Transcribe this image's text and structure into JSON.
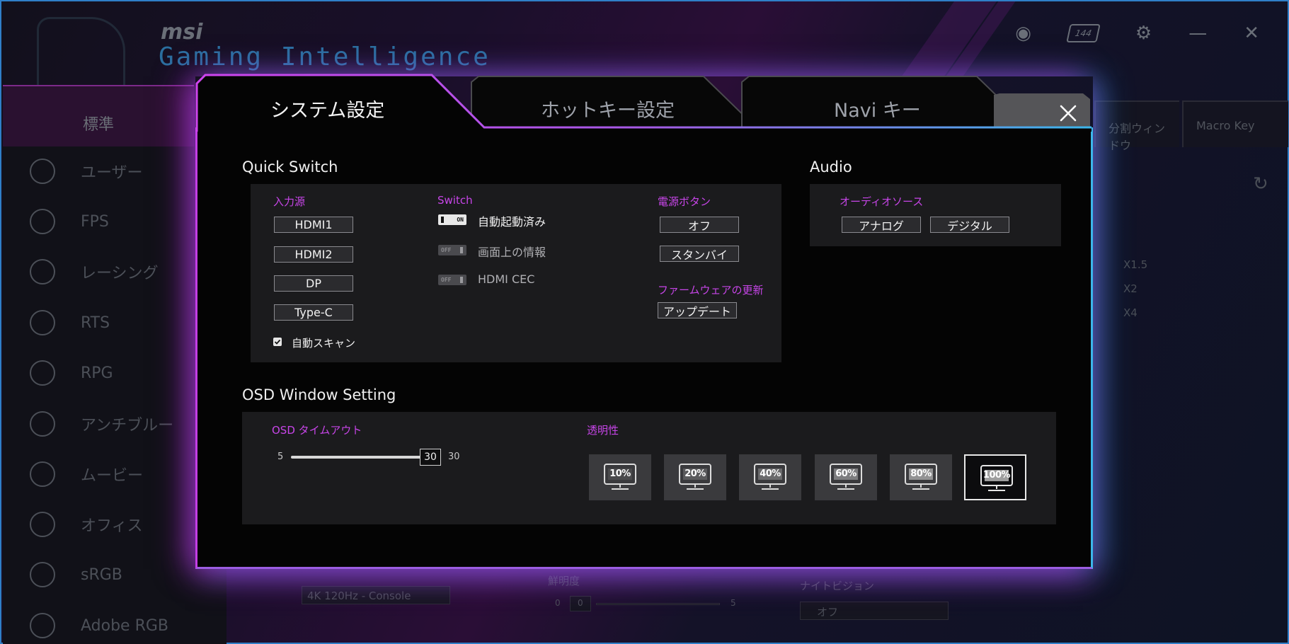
{
  "background": {
    "brand": "msi",
    "app_title": "Gaming Intelligence",
    "refresh_rate": "144",
    "std_tab": "標準",
    "sidebar": [
      "ユーザー",
      "FPS",
      "レーシング",
      "RTS",
      "RPG",
      "アンチブルー",
      "ムービー",
      "オフィス",
      "sRGB",
      "Adobe RGB"
    ],
    "right_tabs": [
      "分割ウィンドウ",
      "Macro Key"
    ],
    "zoom": [
      "X1.5",
      "X2",
      "X4"
    ],
    "resolution": "4K 120Hz - Console",
    "brightness_label": "鮮明度",
    "brightness_min": "0",
    "brightness_val": "0",
    "brightness_max": "5",
    "night_label": "ナイトビジョン",
    "night_val": "オフ"
  },
  "tabs": [
    "システム設定",
    "ホットキー設定",
    "Navi キー"
  ],
  "quick_switch": {
    "title": "Quick Switch",
    "input_label": "入力源",
    "inputs": [
      "HDMI1",
      "HDMI2",
      "DP",
      "Type-C"
    ],
    "auto_scan": "自動スキャン",
    "switch_label": "Switch",
    "switches": [
      {
        "label": "自動起動済み",
        "state": "ON"
      },
      {
        "label": "画面上の情報",
        "state": "OFF"
      },
      {
        "label": "HDMI CEC",
        "state": "OFF"
      }
    ],
    "power_label": "電源ボタン",
    "power_options": [
      "オフ",
      "スタンバイ"
    ],
    "firmware_label": "ファームウェアの更新",
    "firmware_button": "アップデート"
  },
  "audio": {
    "title": "Audio",
    "source_label": "オーディオソース",
    "options": [
      "アナログ",
      "デジタル"
    ]
  },
  "osd": {
    "title": "OSD Window Setting",
    "timeout_label": "OSD タイムアウト",
    "timeout_min": "5",
    "timeout_value": "30",
    "timeout_max": "30",
    "transparency_label": "透明性",
    "transparency_options": [
      "10%",
      "20%",
      "40%",
      "60%",
      "80%",
      "100%"
    ],
    "transparency_selected": "100%"
  },
  "colors": {
    "accent_magenta": "#c745e8",
    "accent_cyan": "#3cb6ea"
  }
}
